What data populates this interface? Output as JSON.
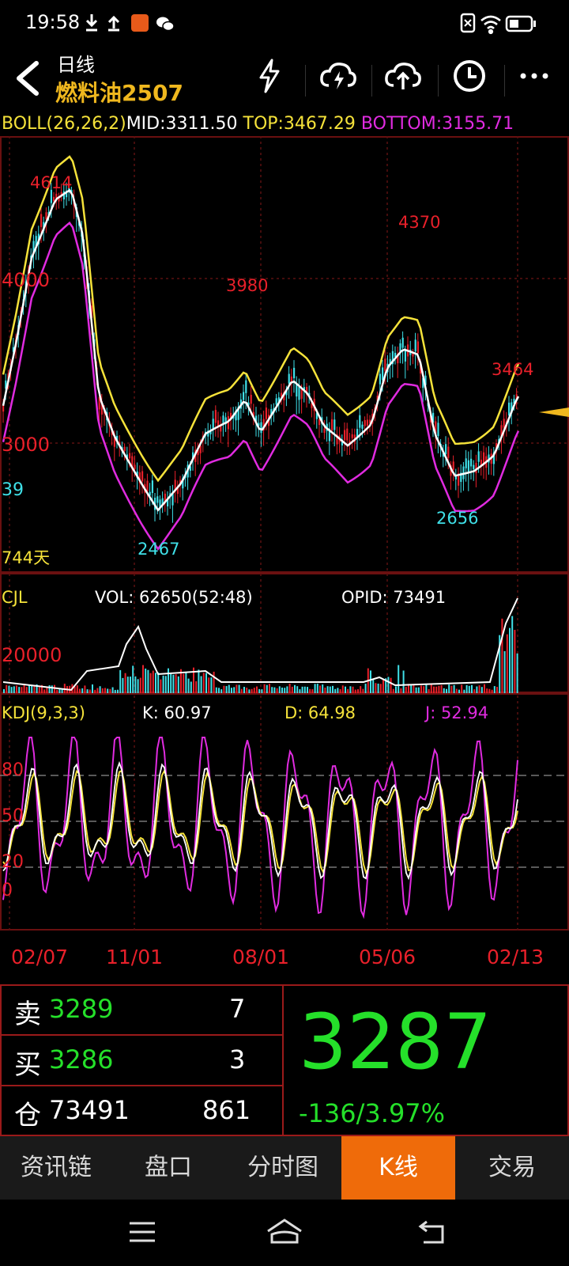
{
  "status_bar": {
    "time": "19:58"
  },
  "header": {
    "title": "日线",
    "contract": "燃料油2507"
  },
  "boll": {
    "label": "BOLL(26,26,2)",
    "mid": "MID:3311.50",
    "top": "TOP:3467.29",
    "bottom": "BOTTOM:3155.71"
  },
  "price_chart": {
    "y_labels": [
      "4000",
      "3000"
    ],
    "left_edge_label": "39",
    "day_count": "744天",
    "annotations": {
      "high1": "4614",
      "high2": "3980",
      "high3": "4370",
      "recent_high": "3464",
      "low1": "2467",
      "low2": "2656"
    }
  },
  "volume": {
    "label": "CJL",
    "vol": "VOL: 62650(52:48)",
    "opid": "OPID: 73491",
    "y_label": "20000"
  },
  "kdj": {
    "label": "KDJ(9,3,3)",
    "k": "K: 60.97",
    "d": "D: 64.98",
    "j": "J: 52.94",
    "y_labels": [
      "80",
      "50",
      "20",
      "0"
    ]
  },
  "date_axis": [
    "02/07",
    "11/01",
    "08/01",
    "05/06",
    "02/13"
  ],
  "quote": {
    "sell_label": "卖",
    "sell_price": "3289",
    "sell_qty": "7",
    "buy_label": "买",
    "buy_price": "3286",
    "buy_qty": "3",
    "oi_label": "仓",
    "oi_value": "73491",
    "oi_change": "861",
    "last_price": "3287",
    "change": "-136/3.97%"
  },
  "tabs": [
    {
      "label": "资讯链"
    },
    {
      "label": "盘口"
    },
    {
      "label": "分时图"
    },
    {
      "label": "K线",
      "active": true
    },
    {
      "label": "交易"
    }
  ],
  "colors": {
    "accent": "#ef6b0a",
    "up": "#e8202a",
    "down": "#3fe0e8",
    "boll_top": "#f5e23a",
    "boll_bottom": "#e02be0",
    "price_green": "#25e02a"
  }
}
